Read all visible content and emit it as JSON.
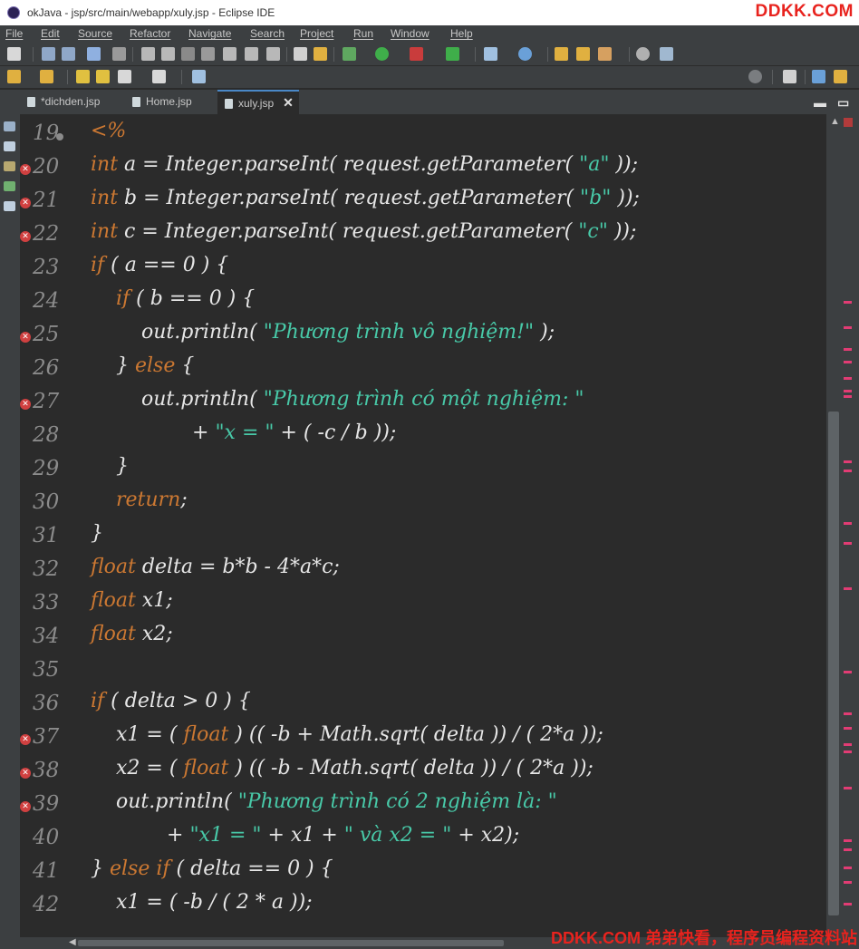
{
  "window": {
    "title": "okJava - jsp/src/main/webapp/xuly.jsp - Eclipse IDE",
    "watermark": "DDKK.COM"
  },
  "menu": [
    "File",
    "Edit",
    "Source",
    "Refactor",
    "Navigate",
    "Search",
    "Project",
    "Run",
    "Window",
    "Help"
  ],
  "tabs": [
    {
      "label": "*dichden.jsp",
      "active": false
    },
    {
      "label": "Home.jsp",
      "active": false
    },
    {
      "label": "xuly.jsp",
      "active": true
    }
  ],
  "colors": {
    "background": "#2b2b2b",
    "keyword": "#cc7832",
    "string": "#48c9a8",
    "text": "#e6e6e6",
    "line_number": "#8b8b8b",
    "error_marker": "#d04040"
  },
  "editor": {
    "lines": [
      {
        "num": "19",
        "error": false,
        "fold": true,
        "indent": 0,
        "tokens": [
          {
            "t": "<%",
            "c": "kw"
          }
        ]
      },
      {
        "num": "20",
        "error": true,
        "indent": 0,
        "tokens": [
          {
            "t": "int",
            "c": "kw"
          },
          {
            "t": " a = Integer.parseInt( request.getParameter( "
          },
          {
            "t": "\"a\"",
            "c": "str"
          },
          {
            "t": " ));"
          }
        ]
      },
      {
        "num": "21",
        "error": true,
        "indent": 0,
        "tokens": [
          {
            "t": "int",
            "c": "kw"
          },
          {
            "t": " b = Integer.parseInt( request.getParameter( "
          },
          {
            "t": "\"b\"",
            "c": "str"
          },
          {
            "t": " ));"
          }
        ]
      },
      {
        "num": "22",
        "error": true,
        "indent": 0,
        "tokens": [
          {
            "t": "int",
            "c": "kw"
          },
          {
            "t": " c = Integer.parseInt( request.getParameter( "
          },
          {
            "t": "\"c\"",
            "c": "str"
          },
          {
            "t": " ));"
          }
        ]
      },
      {
        "num": "23",
        "error": false,
        "indent": 0,
        "tokens": [
          {
            "t": "if",
            "c": "kw"
          },
          {
            "t": " ( a == 0 ) {"
          }
        ]
      },
      {
        "num": "24",
        "error": false,
        "indent": 1,
        "tokens": [
          {
            "t": "if",
            "c": "kw"
          },
          {
            "t": " ( b == 0 ) {"
          }
        ]
      },
      {
        "num": "25",
        "error": true,
        "indent": 2,
        "tokens": [
          {
            "t": "out.println( "
          },
          {
            "t": "\"Phương trình vô nghiệm!\"",
            "c": "str"
          },
          {
            "t": " );"
          }
        ]
      },
      {
        "num": "26",
        "error": false,
        "indent": 1,
        "tokens": [
          {
            "t": "} "
          },
          {
            "t": "else",
            "c": "kw"
          },
          {
            "t": " {"
          }
        ]
      },
      {
        "num": "27",
        "error": true,
        "indent": 2,
        "tokens": [
          {
            "t": "out.println( "
          },
          {
            "t": "\"Phương trình có một nghiệm: \"",
            "c": "str"
          }
        ]
      },
      {
        "num": "28",
        "error": false,
        "indent": 4,
        "tokens": [
          {
            "t": "+ "
          },
          {
            "t": "\"x = \"",
            "c": "str"
          },
          {
            "t": " + ( -c / b ));"
          }
        ]
      },
      {
        "num": "29",
        "error": false,
        "indent": 1,
        "tokens": [
          {
            "t": "}"
          }
        ]
      },
      {
        "num": "30",
        "error": false,
        "indent": 1,
        "tokens": [
          {
            "t": "return",
            "c": "kw"
          },
          {
            "t": ";"
          }
        ]
      },
      {
        "num": "31",
        "error": false,
        "indent": 0,
        "tokens": [
          {
            "t": "}"
          }
        ]
      },
      {
        "num": "32",
        "error": false,
        "indent": 0,
        "tokens": [
          {
            "t": "float",
            "c": "kw"
          },
          {
            "t": " delta = b*b - 4*a*c;"
          }
        ]
      },
      {
        "num": "33",
        "error": false,
        "indent": 0,
        "tokens": [
          {
            "t": "float",
            "c": "kw"
          },
          {
            "t": " x1;"
          }
        ]
      },
      {
        "num": "34",
        "error": false,
        "indent": 0,
        "tokens": [
          {
            "t": "float",
            "c": "kw"
          },
          {
            "t": " x2;"
          }
        ]
      },
      {
        "num": "35",
        "error": false,
        "indent": 0,
        "tokens": []
      },
      {
        "num": "36",
        "error": false,
        "indent": 0,
        "tokens": [
          {
            "t": "if",
            "c": "kw"
          },
          {
            "t": " ( delta > 0 ) {"
          }
        ]
      },
      {
        "num": "37",
        "error": true,
        "indent": 1,
        "tokens": [
          {
            "t": "x1 = ( "
          },
          {
            "t": "float",
            "c": "kw"
          },
          {
            "t": " ) (( -b + Math.sqrt( delta )) / ( 2*a ));"
          }
        ]
      },
      {
        "num": "38",
        "error": true,
        "indent": 1,
        "tokens": [
          {
            "t": "x2 = ( "
          },
          {
            "t": "float",
            "c": "kw"
          },
          {
            "t": " ) (( -b - Math.sqrt( delta )) / ( 2*a ));"
          }
        ]
      },
      {
        "num": "39",
        "error": true,
        "indent": 1,
        "tokens": [
          {
            "t": "out.println( "
          },
          {
            "t": "\"Phương trình có 2 nghiệm là: \"",
            "c": "str"
          }
        ]
      },
      {
        "num": "40",
        "error": false,
        "indent": 3,
        "tokens": [
          {
            "t": "+ "
          },
          {
            "t": "\"x1 = \"",
            "c": "str"
          },
          {
            "t": " + x1 + "
          },
          {
            "t": "\" và x2 = \"",
            "c": "str"
          },
          {
            "t": " + x2);"
          }
        ]
      },
      {
        "num": "41",
        "error": false,
        "indent": 0,
        "tokens": [
          {
            "t": "} "
          },
          {
            "t": "else if",
            "c": "kw"
          },
          {
            "t": " ( delta == 0 ) {"
          }
        ]
      },
      {
        "num": "42",
        "error": false,
        "indent": 1,
        "tokens": [
          {
            "t": "x1 = ( -b / ( 2 * a ));"
          }
        ]
      }
    ]
  },
  "footer": {
    "watermark": "DDKK.COM 弟弟快看，程序员编程资料站"
  }
}
